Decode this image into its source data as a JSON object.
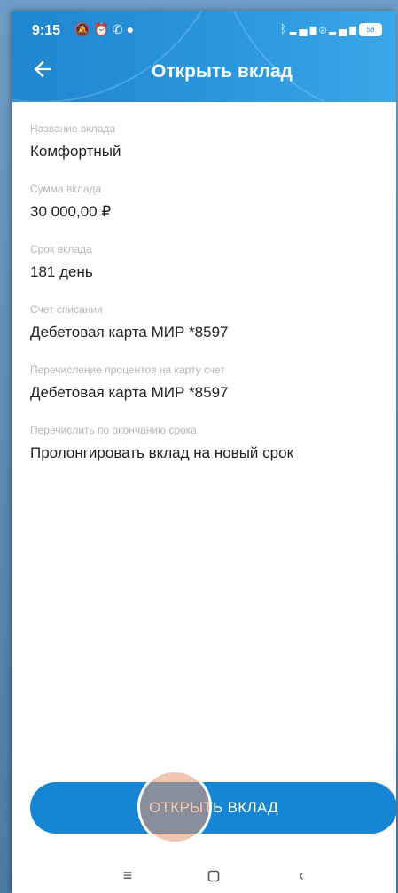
{
  "status_bar": {
    "time": "9:15",
    "left_icons": [
      "mute-icon",
      "alarm-icon",
      "whatsapp-icon",
      "chat-icon"
    ],
    "right_icons": [
      "bluetooth-icon",
      "signal-4g-icon",
      "r-icon",
      "signal-icon",
      "battery-icon"
    ],
    "battery_level": "58"
  },
  "header": {
    "title": "Открыть вклад",
    "back_icon": "arrow-left-icon"
  },
  "fields": [
    {
      "label": "Название вклада",
      "value": "Комфортный"
    },
    {
      "label": "Сумма вклада",
      "value": "30 000,00 ₽"
    },
    {
      "label": "Срок вклада",
      "value": "181 день"
    },
    {
      "label": "Счет списания",
      "value": "Дебетовая карта МИР *8597"
    },
    {
      "label": "Перечисление процентов на карту счет",
      "value": "Дебетовая карта МИР *8597"
    },
    {
      "label": "Перечислить по окончанию срока",
      "value": "Пролонгировать вклад на новый срок"
    }
  ],
  "action": {
    "open_label": "ОТКРЫТЬ ВКЛАД"
  },
  "nav": {
    "menu_icon": "menu-icon",
    "home_icon": "home-square-icon",
    "back_icon": "back-chevron-icon"
  },
  "colors": {
    "accent": "#1686d4",
    "header": "#2a96dc",
    "label": "#b3b6bb",
    "value": "#222222"
  }
}
